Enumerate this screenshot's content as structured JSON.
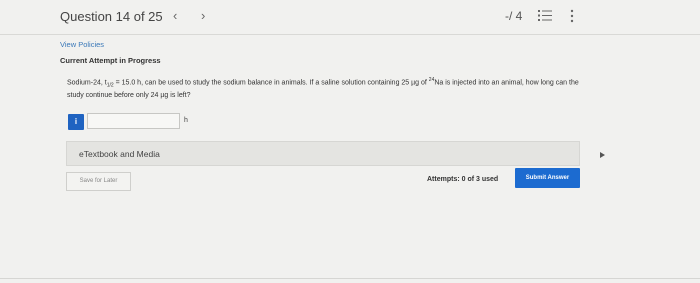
{
  "header": {
    "question_label": "Question 14 of 25",
    "prev_icon": "chevron-left-icon",
    "next_icon": "chevron-right-icon",
    "score": "-/ 4",
    "list_icon": "list-icon",
    "more_icon": "more-vertical-icon"
  },
  "links": {
    "view_policies": "View Policies"
  },
  "status": {
    "attempt_status": "Current Attempt in Progress"
  },
  "question": {
    "text_part1": "Sodium-24, t",
    "half_life_sub": "1/2",
    "text_part2": " = 15.0 h, can be used to study the sodium balance in animals. If a saline solution containing 25 µg of ",
    "isotope_sup": "24",
    "text_part3": "Na is injected into an animal, how long can the study continue before only 24 µg is left?"
  },
  "answer": {
    "info_label": "i",
    "value": "",
    "unit": "h"
  },
  "etextbook": {
    "label": "eTextbook and Media"
  },
  "footer": {
    "save_label": "Save for Later",
    "attempts": "Attempts: 0 of 3 used",
    "submit_label": "Submit Answer"
  },
  "colors": {
    "accent": "#1c6bd0",
    "link": "#3a78b8",
    "background": "#f1f1ef"
  }
}
